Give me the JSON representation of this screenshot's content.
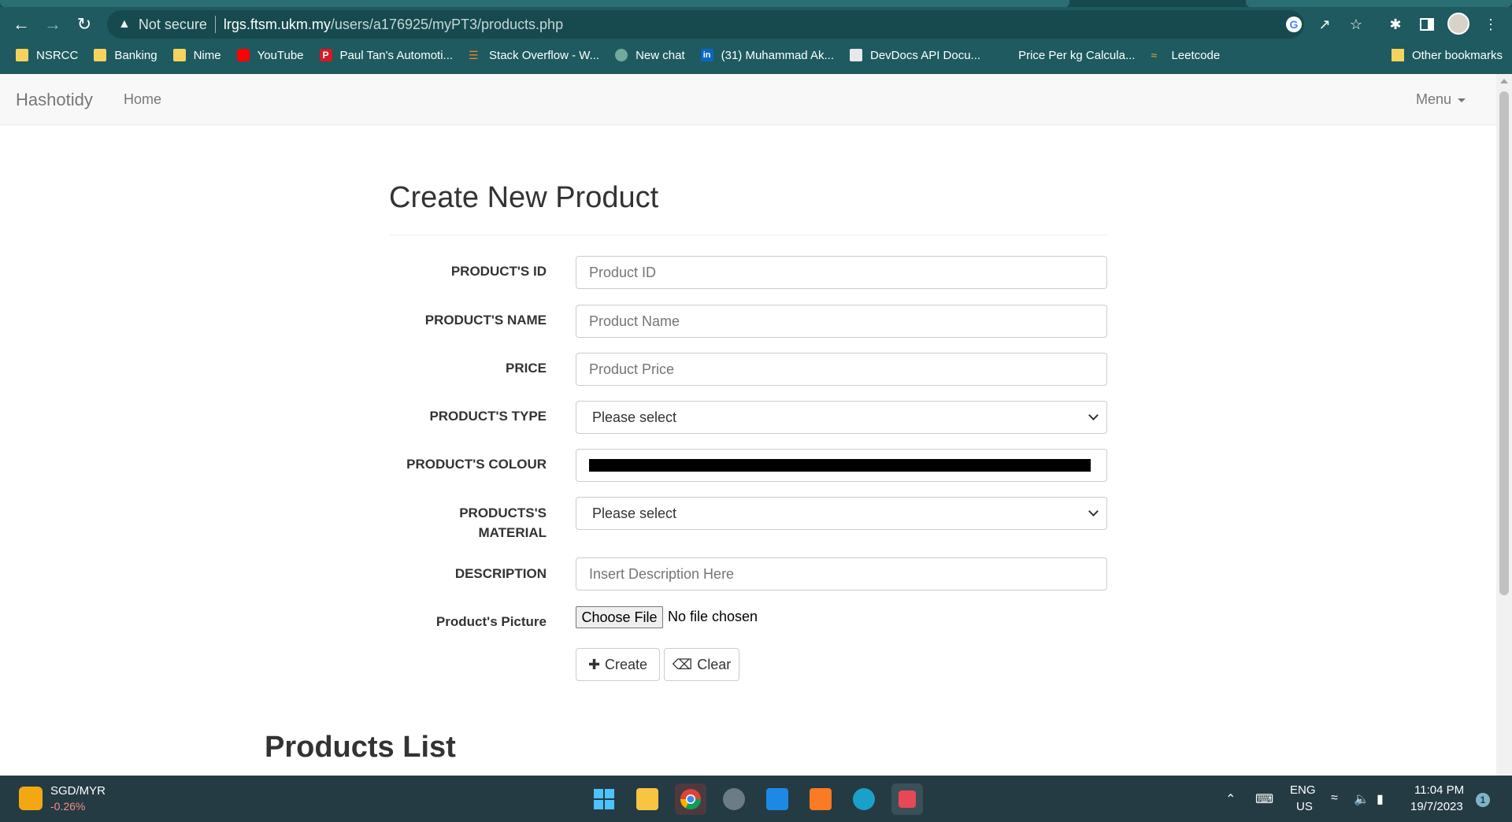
{
  "browser": {
    "security_label": "Not secure",
    "url_host": "lrgs.ftsm.ukm.my",
    "url_path": "/users/a176925/myPT3/products.php",
    "bookmarks": [
      {
        "label": "NSRCC",
        "icon": "folder-icon"
      },
      {
        "label": "Banking",
        "icon": "folder-icon"
      },
      {
        "label": "Nime",
        "icon": "folder-icon"
      },
      {
        "label": "YouTube",
        "icon": "youtube-icon"
      },
      {
        "label": "Paul Tan's Automoti...",
        "icon": "paultan-icon"
      },
      {
        "label": "Stack Overflow - W...",
        "icon": "stackoverflow-icon"
      },
      {
        "label": "New chat",
        "icon": "chatgpt-icon"
      },
      {
        "label": "(31) Muhammad Ak...",
        "icon": "linkedin-icon"
      },
      {
        "label": "DevDocs API Docu...",
        "icon": "devdocs-icon"
      },
      {
        "label": "Price Per kg Calcula...",
        "icon": "blank-icon"
      },
      {
        "label": "Leetcode",
        "icon": "leetcode-icon"
      }
    ],
    "other_bookmarks": "Other bookmarks"
  },
  "navbar": {
    "brand": "Hashotidy",
    "home": "Home",
    "menu": "Menu"
  },
  "form": {
    "title": "Create New Product",
    "fields": {
      "id": {
        "label": "PRODUCT'S ID",
        "placeholder": "Product ID"
      },
      "name": {
        "label": "PRODUCT'S NAME",
        "placeholder": "Product Name"
      },
      "price": {
        "label": "PRICE",
        "placeholder": "Product Price"
      },
      "type": {
        "label": "PRODUCT'S TYPE",
        "value": "Please select"
      },
      "colour": {
        "label": "PRODUCT'S COLOUR",
        "value": "#000000"
      },
      "material": {
        "label_line1": "PRODUCTS'S",
        "label_line2": "MATERIAL",
        "value": "Please select"
      },
      "description": {
        "label": "DESCRIPTION",
        "placeholder": "Insert Description Here"
      },
      "picture": {
        "label": "Product's Picture",
        "button": "Choose File",
        "status": "No file chosen"
      }
    },
    "create_label": "Create",
    "clear_label": "Clear"
  },
  "products_list_title": "Products List",
  "taskbar": {
    "widget_title": "SGD/MYR",
    "widget_change": "-0.26%",
    "lang_line1": "ENG",
    "lang_line2": "US",
    "time": "11:04 PM",
    "date": "19/7/2023",
    "notification_count": "1"
  }
}
